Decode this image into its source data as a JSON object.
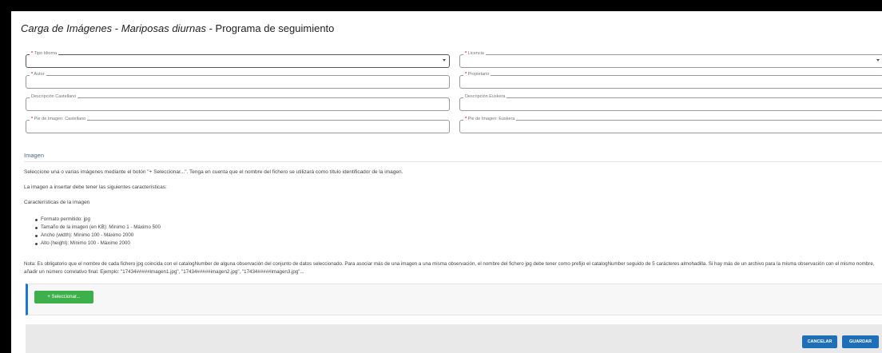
{
  "title": {
    "part1": "Carga de Imágenes",
    "sep1": " - ",
    "part2": "Mariposas diurnas",
    "sep2": " - ",
    "part3": "Programa de seguimiento"
  },
  "form": {
    "tipo_idioma": {
      "label": "Tipo Idioma",
      "required": "*",
      "value": ""
    },
    "licencia": {
      "label": "Licencia",
      "required": "*",
      "value": ""
    },
    "autor": {
      "label": "Autor",
      "required": "*",
      "value": ""
    },
    "propietario": {
      "label": "Propietario",
      "required": "*",
      "value": ""
    },
    "descripcion_castellano": {
      "label": "Descripción Castellano",
      "value": ""
    },
    "descripcion_euskera": {
      "label": "Descripción Euskera",
      "value": ""
    },
    "pie_castellano": {
      "label": "Pie de Imagen: Castellano",
      "required": "*",
      "value": ""
    },
    "pie_euskera": {
      "label": "Pie de Imagen: Euskera",
      "required": "*",
      "value": ""
    }
  },
  "section": {
    "title": "Imagen",
    "intro": "Seleccione una o varias imágenes mediante el botón \"+ Seleccionar...\". Tenga en cuenta que el nombre del fichero se utilizará como título identificador de la imagen.",
    "requirements_intro": "La imagen a insertar debe tener las siguientes características:",
    "characteristics_title": "Características de la imagen",
    "characteristics": [
      "Formato permitido: jpg",
      "Tamaño de la imagen (en KB): Mínimo 1 - Máximo 500",
      "Ancho (width): Mínimo 100 - Máximo 2000",
      "Alto (height): Mínimo 100 - Máximo 2000"
    ],
    "note": "Nota: Es obligatorio que el nombre de cada fichero jpg coincida con el catalogNumber de alguna observación del conjunto de datos seleccionado. Para asociar más de una imagen a una misma observación, el nombre del fichero jpg debe tener como prefijo el catalogNumber seguido de 5 carácteres almohadilla. Si hay más de un archivo para la misma observación con el mismo nombre, añadir un número correlativo final. Ejemplo: \"17434#####imagen1.jpg\", \"17434#####imagen2.jpg\", \"17434#####imagen3.jpg\"..."
  },
  "upload": {
    "select_label": "+ Seleccionar..."
  },
  "actions": {
    "cancel_label": "CANCELAR",
    "save_label": "GUARDAR"
  },
  "colors": {
    "primary": "#1e6fb8",
    "select": "#3eb04b",
    "required": "#d32f2f",
    "accent_border": "#1976d2"
  }
}
